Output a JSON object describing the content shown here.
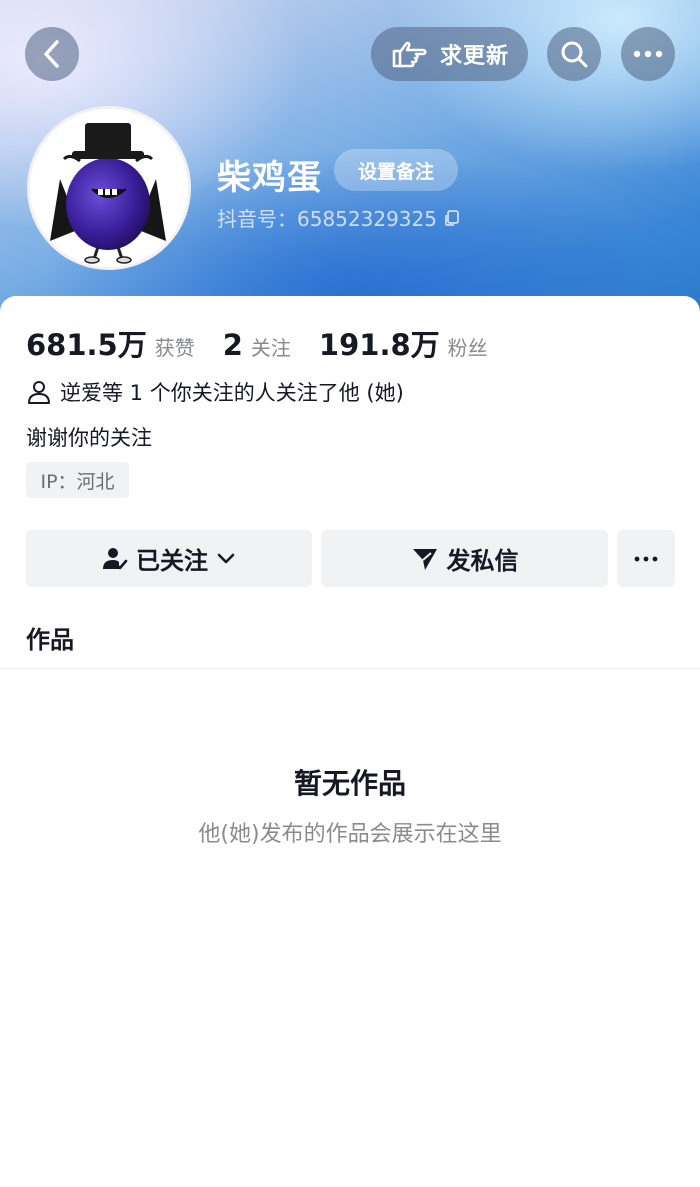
{
  "header": {
    "update_label": "求更新",
    "icons": [
      "back-arrow-icon",
      "pointing-hand-icon",
      "search-icon",
      "more-dots-icon"
    ]
  },
  "profile": {
    "nickname": "柴鸡蛋",
    "remark_label": "设置备注",
    "douyin_id": "抖音号：65852329325",
    "avatar": "purple-eggplant-character-avatar"
  },
  "stats": [
    {
      "value": "681.5万",
      "label": "获赞"
    },
    {
      "value": "2",
      "label": "关注"
    },
    {
      "value": "191.8万",
      "label": "粉丝"
    }
  ],
  "mutual_text": "逆爱等 1 个你关注的人关注了他 (她)",
  "bio": "谢谢你的关注",
  "ip_tag": "IP：河北",
  "actions": {
    "follow_label": "已关注",
    "dm_label": "发私信"
  },
  "tabs": {
    "works_label": "作品"
  },
  "empty": {
    "title": "暂无作品",
    "subtitle": "他(她)发布的作品会展示在这里"
  },
  "colors": {
    "header_blue": "#3a86d6",
    "text_primary": "#161823",
    "text_secondary": "#888a90",
    "button_bg": "#f1f2f4"
  }
}
